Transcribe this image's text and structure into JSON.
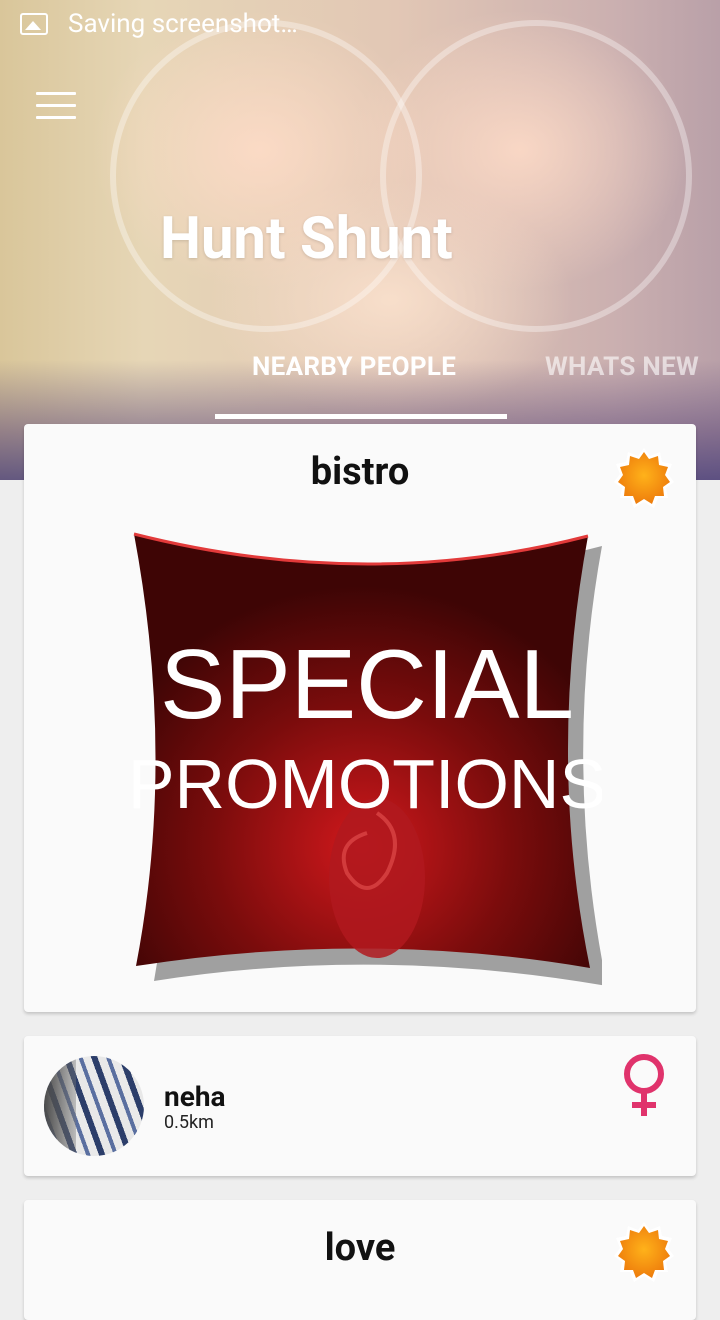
{
  "status_bar": {
    "text": "Saving screenshot…"
  },
  "app": {
    "title": "Hunt Shunt"
  },
  "tabs": [
    {
      "label": "NEARBY PEOPLE",
      "active": true
    },
    {
      "label": "WHATS NEW",
      "active": false
    }
  ],
  "cards": [
    {
      "type": "promo",
      "title": "bistro",
      "image_text_line1": "SPECIAL",
      "image_text_line2": "PROMOTIONS",
      "badge_icon": "sun-badge-icon"
    },
    {
      "type": "person",
      "name": "neha",
      "distance": "0.5km",
      "gender_icon": "female-icon"
    },
    {
      "type": "promo",
      "title": "love",
      "badge_icon": "sun-badge-icon"
    }
  ],
  "colors": {
    "accent_pink": "#e0336c",
    "badge_orange": "#f39212",
    "promo_red": "#7a0c0c"
  }
}
